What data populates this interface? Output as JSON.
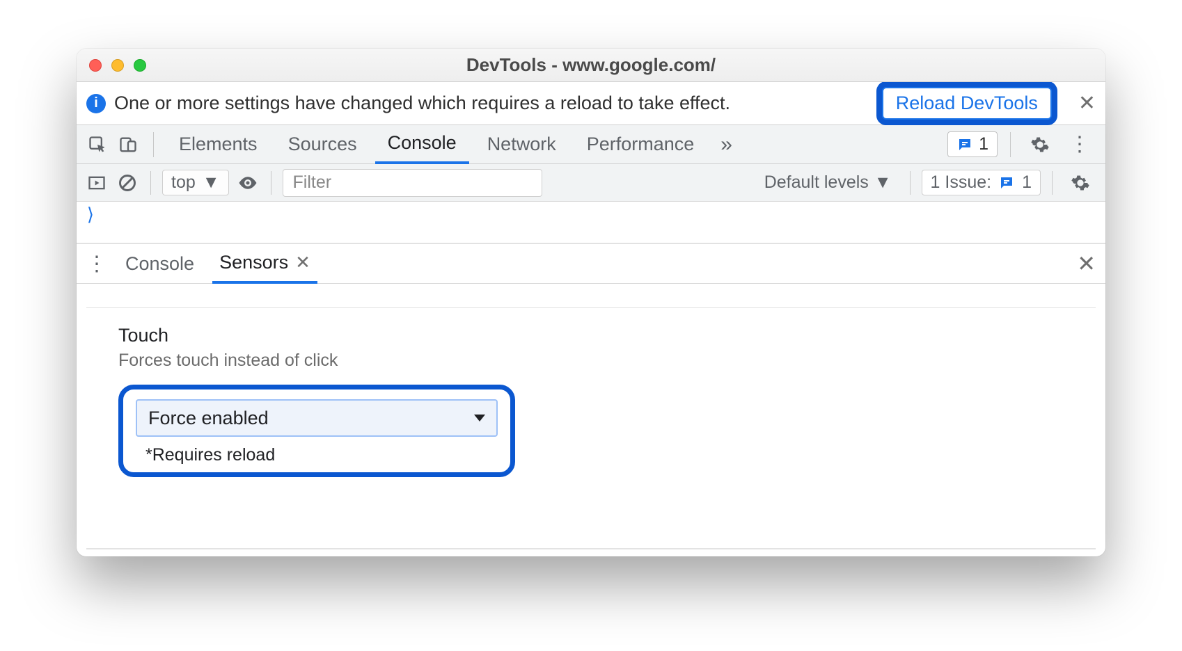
{
  "window": {
    "title": "DevTools - www.google.com/"
  },
  "infobar": {
    "message": "One or more settings have changed which requires a reload to take effect.",
    "button": "Reload DevTools"
  },
  "tabs": {
    "items": [
      "Elements",
      "Sources",
      "Console",
      "Network",
      "Performance"
    ],
    "active_index": 2,
    "issues_count": "1"
  },
  "console_controls": {
    "context": "top",
    "filter_placeholder": "Filter",
    "levels": "Default levels",
    "issues_label": "1 Issue:",
    "issues_count": "1"
  },
  "drawer": {
    "tabs": [
      "Console",
      "Sensors"
    ],
    "active_index": 1
  },
  "sensors": {
    "section_label": "Touch",
    "section_desc": "Forces touch instead of click",
    "select_value": "Force enabled",
    "requires_note": "*Requires reload"
  }
}
